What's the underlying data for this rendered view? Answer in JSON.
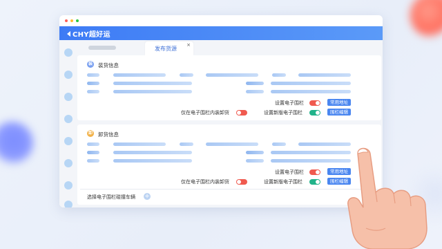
{
  "app": {
    "logo_text": "CHY超好运"
  },
  "tabs": {
    "active_label": "发布货源",
    "close_glyph": "×"
  },
  "section_load": {
    "icon_text": "装",
    "title": "装货信息",
    "fence_label": "设置电子围栏",
    "fence_on": false,
    "common_address_button": "常用地址",
    "inside_fence_label": "仅在电子围栏内装卸货",
    "inside_fence_on": false,
    "new_fence_label": "设置新版电子围栏",
    "new_fence_on": true,
    "fence_edit_button": "围栏编辑"
  },
  "section_unload": {
    "icon_text": "卸",
    "title": "卸货信息",
    "fence_label": "设置电子围栏",
    "fence_on": false,
    "common_address_button": "常用地址",
    "inside_fence_label": "仅在电子围栏内装卸货",
    "inside_fence_on": false,
    "new_fence_label": "设置新版电子围栏",
    "new_fence_on": true,
    "fence_edit_button": "围栏编辑",
    "bottom_label": "选择电子围栏碰撞车辆",
    "plus_glyph": "+"
  },
  "colors": {
    "accent": "#3d7bf5",
    "toggle_off": "#f05a4f",
    "toggle_on": "#21b38a",
    "button": "#4a86f0"
  }
}
